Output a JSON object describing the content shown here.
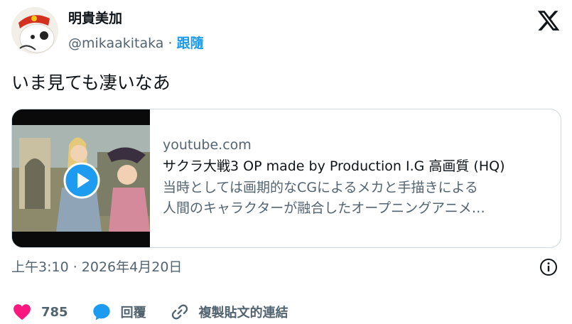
{
  "author": {
    "display_name": "明貴美加",
    "handle": "@mikaakitaka",
    "separator": "·",
    "follow_label": "跟隨"
  },
  "tweet": {
    "text": "いま見ても凄いなあ"
  },
  "card": {
    "domain": "youtube.com",
    "title": "サクラ大戦3 OP made by Production I.G 高画質 (HQ)",
    "description_line1": "当時としては画期的なCGによるメカと手描きによる",
    "description_line2": "人間のキャラクターが融合したオープニングアニメ…"
  },
  "timestamp": "上午3:10 · 2026年4月20日",
  "actions": {
    "like_count": "785",
    "reply_label": "回覆",
    "copy_link_label": "複製貼文的連結"
  },
  "colors": {
    "accent": "#1d9bf0",
    "like": "#f91880",
    "text": "#0f1419",
    "secondary": "#536471"
  }
}
